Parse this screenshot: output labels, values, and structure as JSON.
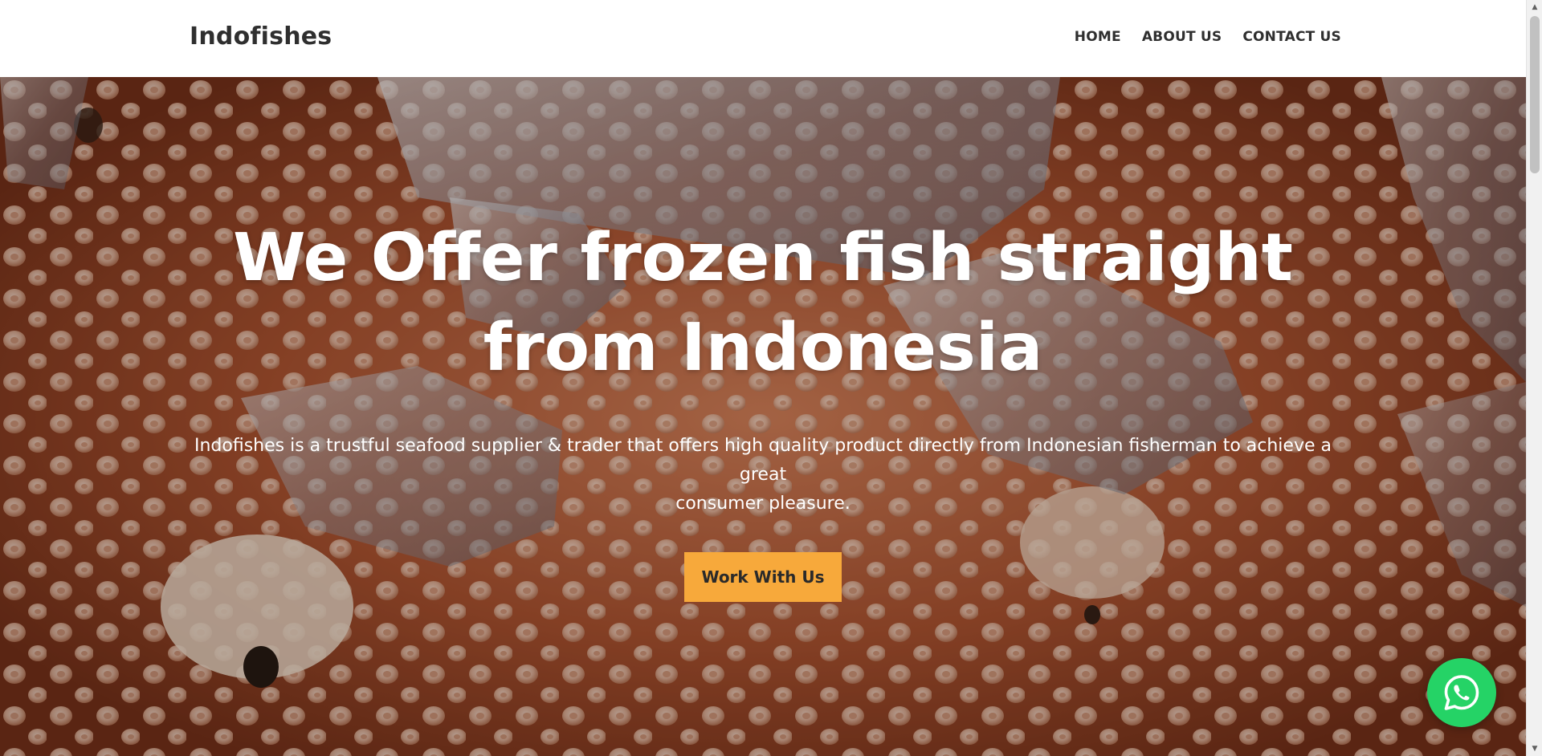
{
  "header": {
    "brand": "Indofishes",
    "nav": [
      {
        "label": "HOME"
      },
      {
        "label": "ABOUT US"
      },
      {
        "label": "CONTACT US"
      }
    ]
  },
  "hero": {
    "title_line1": "We Offer frozen fish straight",
    "title_line2": "from Indonesia",
    "description_line1": "Indofishes is a trustful seafood supplier & trader that offers high quality product directly from Indonesian fisherman to achieve a great",
    "description_line2": "consumer pleasure.",
    "cta_label": "Work With Us",
    "background_image": "octopus-on-ice-photo"
  },
  "floating": {
    "whatsapp_icon": "whatsapp-icon",
    "whatsapp_color": "#25d366"
  },
  "colors": {
    "accent": "#f7a93b",
    "text_dark": "#2f2f2f"
  }
}
